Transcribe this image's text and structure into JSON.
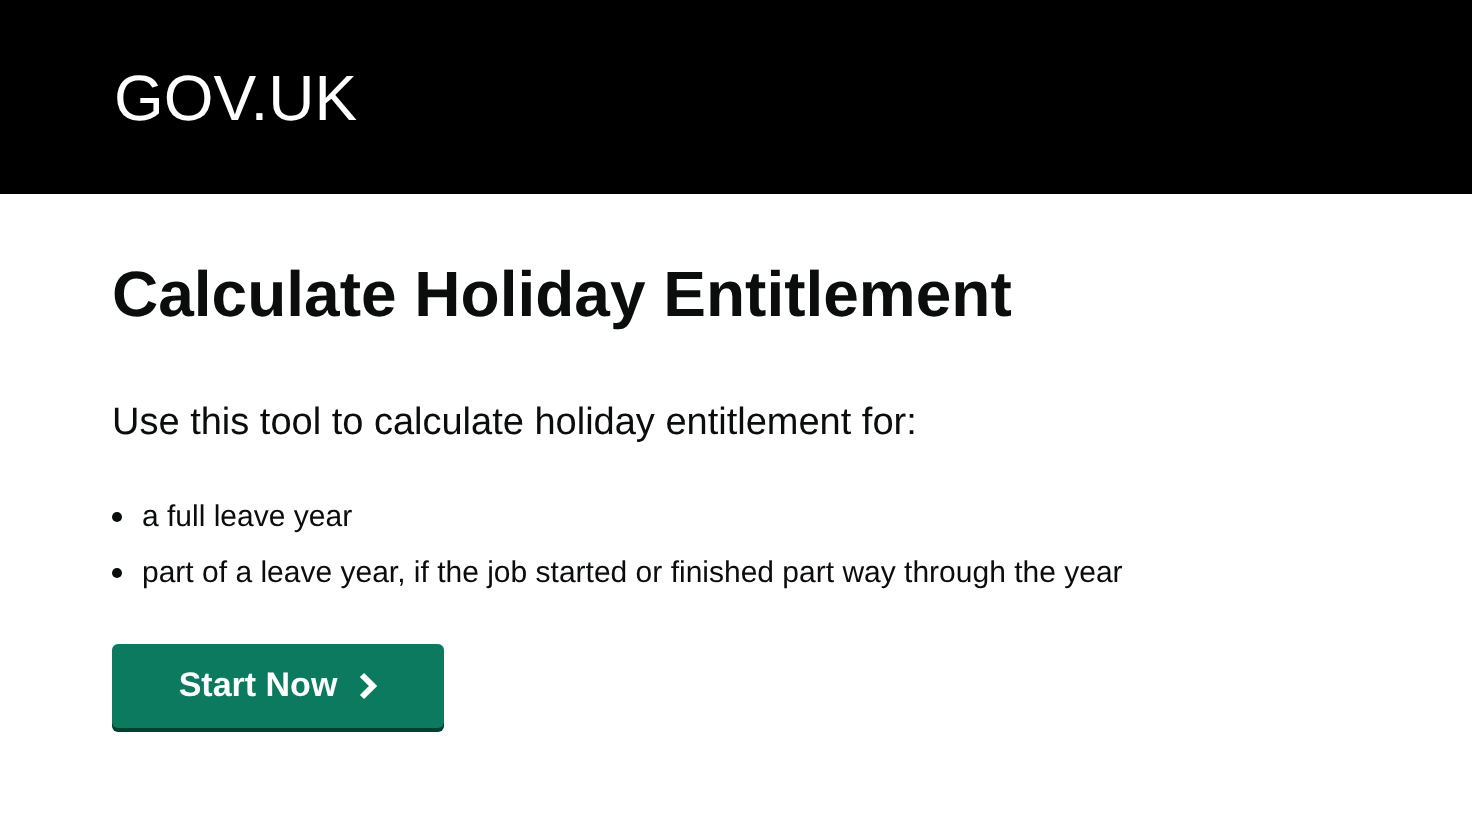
{
  "header": {
    "logo": "GOV.UK"
  },
  "title": "Calculate Holiday Entitlement",
  "intro": "Use this tool to calculate holiday entitlement for:",
  "bullets": [
    "a full leave year",
    "part of a leave year, if the job started or finished part way through the year"
  ],
  "start_button": {
    "label": "Start Now"
  }
}
